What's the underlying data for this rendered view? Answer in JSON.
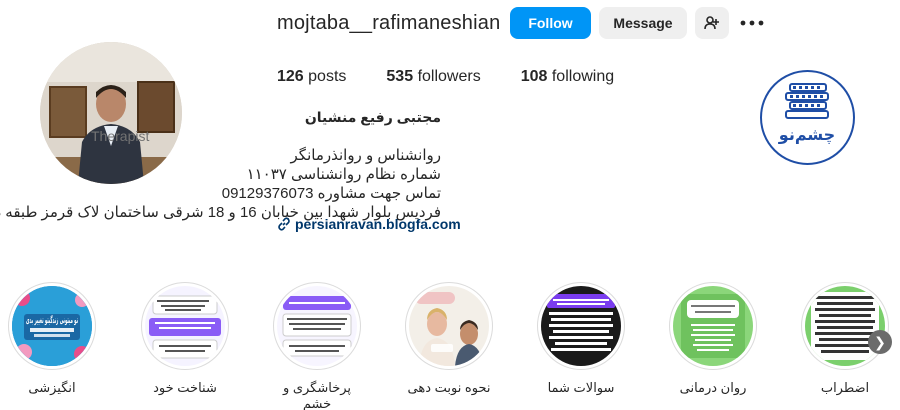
{
  "profile": {
    "username": "mojtaba__rafimaneshian",
    "follow_label": "Follow",
    "message_label": "Message",
    "add_user_icon": "add-user-icon",
    "more_icon": "more-options-icon"
  },
  "stats": {
    "posts_count": "126",
    "posts_label": "posts",
    "followers_count": "535",
    "followers_label": "followers",
    "following_count": "108",
    "following_label": "following"
  },
  "bio": {
    "name": "مجتبی رفیع منشیان",
    "category": "Therapist",
    "line1": "روانشناس و روانذرمانگر",
    "line2": "شماره نظام روانشناسی ۱۱۰۳۷",
    "line3": "تماس جهت مشاوره 09129376073",
    "line4": "فردیس بلوار شهدا بین خیابان 16 و 18 شرقی ساختمان لاک قرمز طبقه دوم د ،",
    "link": "persianravan.blogfa.com"
  },
  "logo": {
    "text": "چشم‌نو"
  },
  "highlights": [
    {
      "label": "انگیزشی",
      "cover_text": "تو میتونی زندگیتو تغییر بدی"
    },
    {
      "label": "شناخت خود"
    },
    {
      "label": "پرخاشگری و خشم"
    },
    {
      "label": "نحوه نوبت دهی"
    },
    {
      "label": "سوالات شما"
    },
    {
      "label": "روان درمانی"
    },
    {
      "label": "اضطراب"
    }
  ],
  "colors": {
    "follow_bg": "#0095f6",
    "link": "#00376b",
    "logo_blue": "#1f4ea6"
  }
}
